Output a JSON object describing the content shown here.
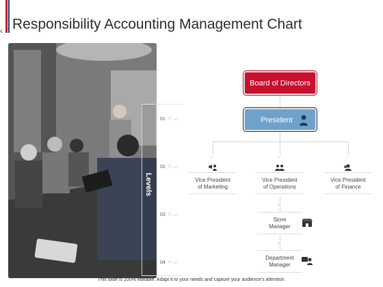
{
  "title": "Responsibility Accounting Management Chart",
  "levels_label": "Levels",
  "levels": [
    "01",
    "02",
    "03",
    "04"
  ],
  "nodes": {
    "board": "Board of Directors",
    "president": "President",
    "vp_marketing": "Vice President\nof Marketing",
    "vp_operations": "Vice President\nof Operations",
    "vp_finance": "Vice President\nof Finance",
    "store_manager": "Store\nManager",
    "department_manager": "Department\nManager"
  },
  "footer": "This slide is 100% editable. Adapt it to your needs and capture your audience's attention.",
  "colors": {
    "accent_red": "#c8102e",
    "accent_blue": "#6ea2cb",
    "navy": "#1f3a5f"
  }
}
